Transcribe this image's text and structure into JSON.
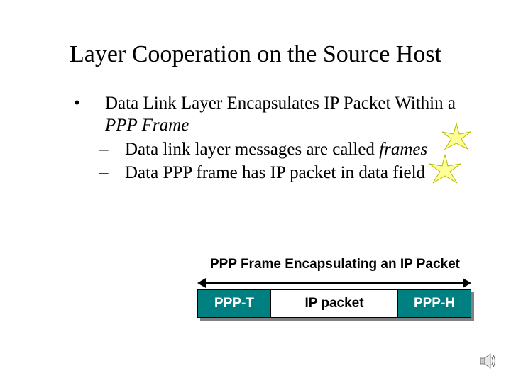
{
  "title": "Layer Cooperation on the Source Host",
  "bullets": {
    "l1_part1": "Data Link Layer Encapsulates IP Packet Within a  ",
    "l1_italic": "PPP Frame",
    "l2a_text": "Data link layer messages are called ",
    "l2a_italic": "frames",
    "l2b": "Data PPP frame has IP packet in data field"
  },
  "diagram": {
    "caption": "PPP Frame Encapsulating an IP Packet",
    "segments": {
      "trailer": "PPP-T",
      "payload": "IP packet",
      "header": "PPP-H"
    }
  },
  "icons": {
    "star": "star-icon",
    "sound": "sound-icon"
  },
  "colors": {
    "teal": "#008080",
    "star_fill": "#ffff99",
    "star_stroke": "#b8b800"
  }
}
